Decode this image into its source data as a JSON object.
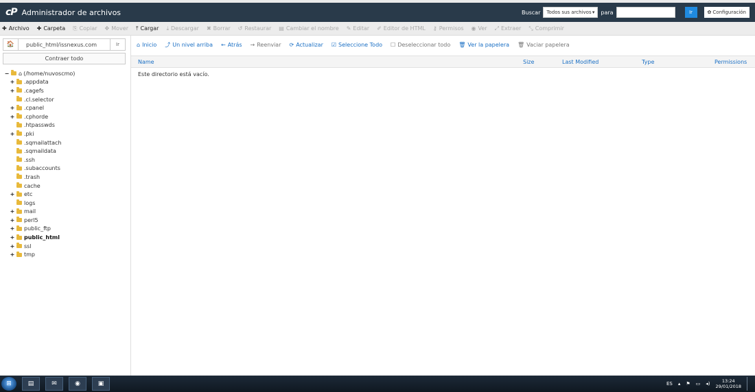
{
  "header": {
    "logo": "cP",
    "title": "Administrador de archivos",
    "search_label": "Buscar",
    "search_scope": "Todos sus archivos",
    "para_label": "para",
    "search_value": "",
    "go_label": "Ir",
    "settings_label": "Configuración"
  },
  "toolbar": {
    "items": [
      {
        "label": "Archivo",
        "icon": "plus-icon",
        "active": true
      },
      {
        "label": "Carpeta",
        "icon": "plus-icon",
        "active": true
      },
      {
        "label": "Copiar",
        "icon": "copy-icon",
        "active": false
      },
      {
        "label": "Mover",
        "icon": "move-icon",
        "active": false
      },
      {
        "label": "Cargar",
        "icon": "upload-icon",
        "active": true
      },
      {
        "label": "Descargar",
        "icon": "download-icon",
        "active": false
      },
      {
        "label": "Borrar",
        "icon": "delete-icon",
        "active": false
      },
      {
        "label": "Restaurar",
        "icon": "restore-icon",
        "active": false
      },
      {
        "label": "Cambiar el nombre",
        "icon": "file-icon",
        "active": false
      },
      {
        "label": "Editar",
        "icon": "pencil-icon",
        "active": false
      },
      {
        "label": "Editor de HTML",
        "icon": "edit-icon",
        "active": false
      },
      {
        "label": "Permisos",
        "icon": "key-icon",
        "active": false
      },
      {
        "label": "Ver",
        "icon": "eye-icon",
        "active": false
      },
      {
        "label": "Extraer",
        "icon": "expand-icon",
        "active": false
      },
      {
        "label": "Comprimir",
        "icon": "compress-icon",
        "active": false
      }
    ]
  },
  "sidebar": {
    "path_value": "public_html/issnexus.com",
    "go_label": "Ir",
    "collapse_label": "Contraer todo",
    "root_label": "(/home/nuvoscmo)",
    "tree": [
      {
        "label": ".appdata",
        "expandable": true,
        "bold": false
      },
      {
        "label": ".cagefs",
        "expandable": true,
        "bold": false
      },
      {
        "label": ".cl.selector",
        "expandable": false,
        "bold": false
      },
      {
        "label": ".cpanel",
        "expandable": true,
        "bold": false
      },
      {
        "label": ".cphorde",
        "expandable": true,
        "bold": false
      },
      {
        "label": ".htpasswds",
        "expandable": false,
        "bold": false
      },
      {
        "label": ".pki",
        "expandable": true,
        "bold": false
      },
      {
        "label": ".sqmailattach",
        "expandable": false,
        "bold": false
      },
      {
        "label": ".sqmaildata",
        "expandable": false,
        "bold": false
      },
      {
        "label": ".ssh",
        "expandable": false,
        "bold": false
      },
      {
        "label": ".subaccounts",
        "expandable": false,
        "bold": false
      },
      {
        "label": ".trash",
        "expandable": false,
        "bold": false
      },
      {
        "label": "cache",
        "expandable": false,
        "bold": false
      },
      {
        "label": "etc",
        "expandable": true,
        "bold": false
      },
      {
        "label": "logs",
        "expandable": false,
        "bold": false
      },
      {
        "label": "mail",
        "expandable": true,
        "bold": false
      },
      {
        "label": "perl5",
        "expandable": true,
        "bold": false
      },
      {
        "label": "public_ftp",
        "expandable": true,
        "bold": false
      },
      {
        "label": "public_html",
        "expandable": true,
        "bold": true
      },
      {
        "label": "ssl",
        "expandable": true,
        "bold": false
      },
      {
        "label": "tmp",
        "expandable": true,
        "bold": false
      }
    ]
  },
  "actions": {
    "items": [
      {
        "label": "Inicio",
        "icon": "home-icon",
        "enabled": true
      },
      {
        "label": "Un nivel arriba",
        "icon": "level-up-icon",
        "enabled": true
      },
      {
        "label": "Atrás",
        "icon": "arrow-left-icon",
        "enabled": true
      },
      {
        "label": "Reenviar",
        "icon": "arrow-right-icon",
        "enabled": false
      },
      {
        "label": "Actualizar",
        "icon": "refresh-icon",
        "enabled": true
      },
      {
        "label": "Seleccione Todo",
        "icon": "checkbox-checked-icon",
        "enabled": true
      },
      {
        "label": "Deseleccionar todo",
        "icon": "checkbox-empty-icon",
        "enabled": false
      },
      {
        "label": "Ver la papelera",
        "icon": "trash-icon",
        "enabled": true
      },
      {
        "label": "Vaciar papelera",
        "icon": "trash-icon",
        "enabled": false
      }
    ]
  },
  "table": {
    "columns": [
      "Name",
      "Size",
      "Last Modified",
      "Type",
      "Permissions"
    ],
    "empty_message": "Este directorio está vacío."
  },
  "taskbar": {
    "language": "ES",
    "time": "13:24",
    "date": "29/01/2018"
  }
}
